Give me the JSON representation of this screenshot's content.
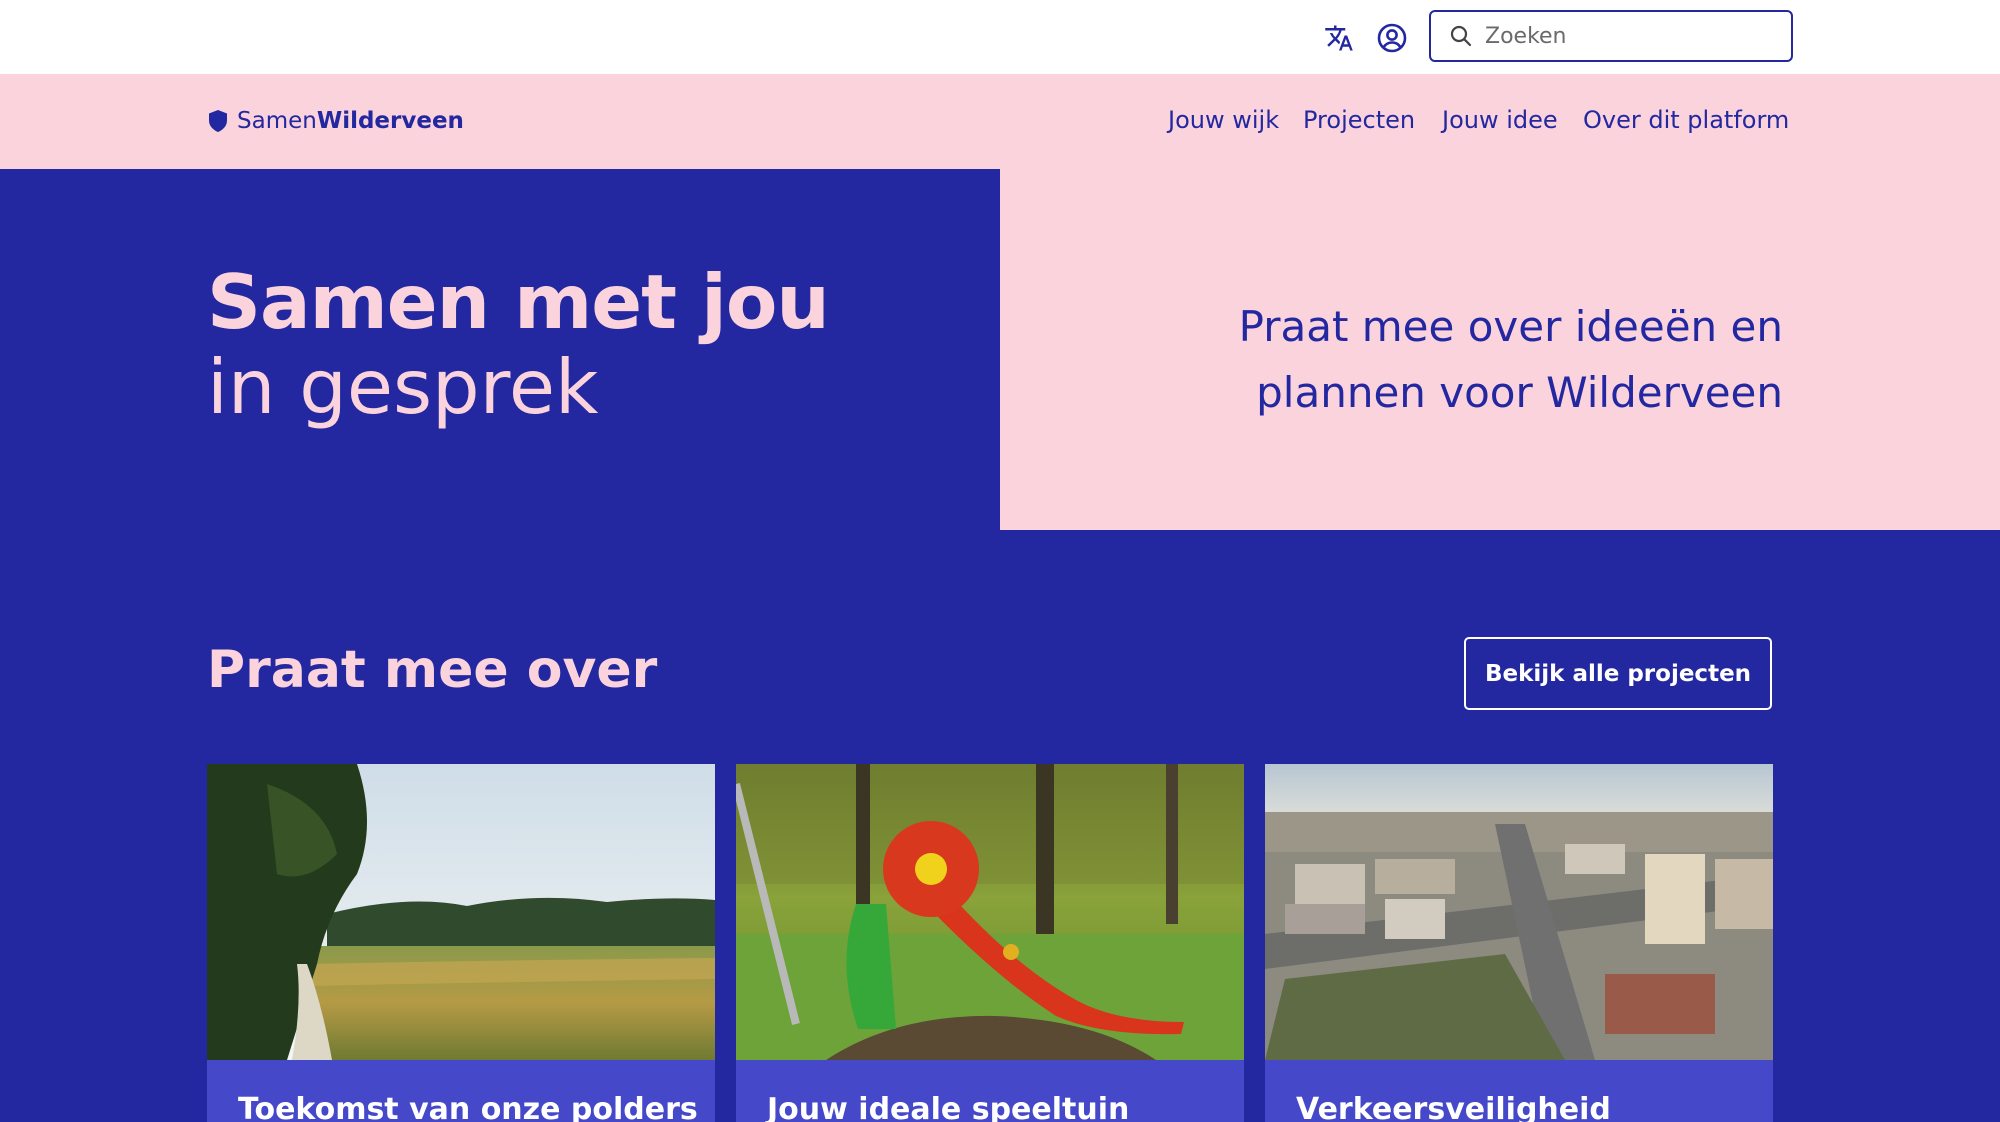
{
  "topbar": {
    "translate_icon": "translate-icon",
    "account_icon": "user-circle-icon",
    "search": {
      "placeholder": "Zoeken",
      "value": ""
    }
  },
  "brand": {
    "prefix": "Samen",
    "name": "Wilderveen",
    "icon": "shield-icon"
  },
  "nav": {
    "items": [
      {
        "label": "Jouw wijk"
      },
      {
        "label": "Projecten"
      },
      {
        "label": "Jouw idee"
      },
      {
        "label": "Over dit platform"
      }
    ]
  },
  "hero": {
    "title_line1": "Samen met jou",
    "title_line2": "in gesprek",
    "subtitle": "Praat mee over ideeën en plannen voor Wilderveen"
  },
  "section": {
    "title": "Praat mee over",
    "button_label": "Bekijk alle projecten"
  },
  "cards": [
    {
      "title": "Toekomst van onze polders",
      "image": "polder-landscape-photo"
    },
    {
      "title": "Jouw ideale speeltuin",
      "image": "playground-slide-photo"
    },
    {
      "title": "Verkeersveiligheid",
      "image": "aerial-city-traffic-photo"
    }
  ],
  "colors": {
    "primary_blue": "#2328a0",
    "light_pink": "#fad3dd",
    "card_blue": "#4548c9"
  }
}
